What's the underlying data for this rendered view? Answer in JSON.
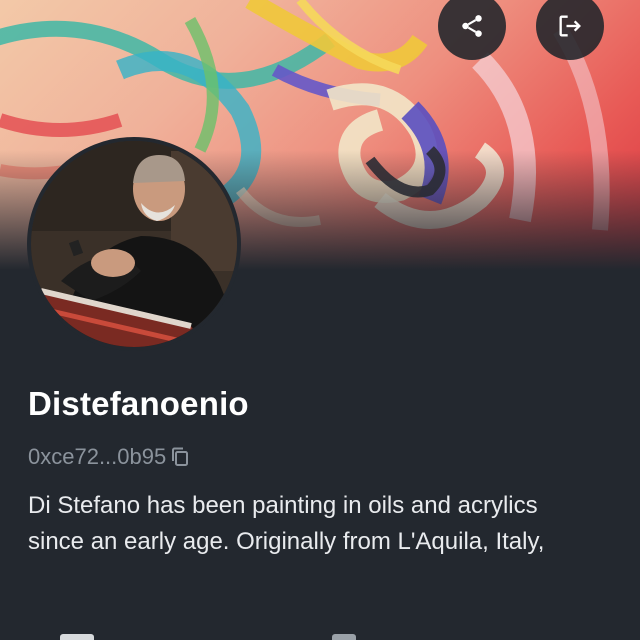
{
  "profile": {
    "name": "Distefanoenio",
    "address": "0xce72...0b95",
    "bio": "Di Stefano has been painting in oils and acrylics since an early age. Originally from L'Aquila, Italy,"
  },
  "icons": {
    "share": "share-icon",
    "logout": "logout-icon",
    "copy": "copy-icon"
  },
  "colors": {
    "background": "#23282f",
    "name_text": "#ffffff",
    "address_text": "#8b939c",
    "bio_text": "#e9ebee",
    "button_bg": "#20242a"
  }
}
